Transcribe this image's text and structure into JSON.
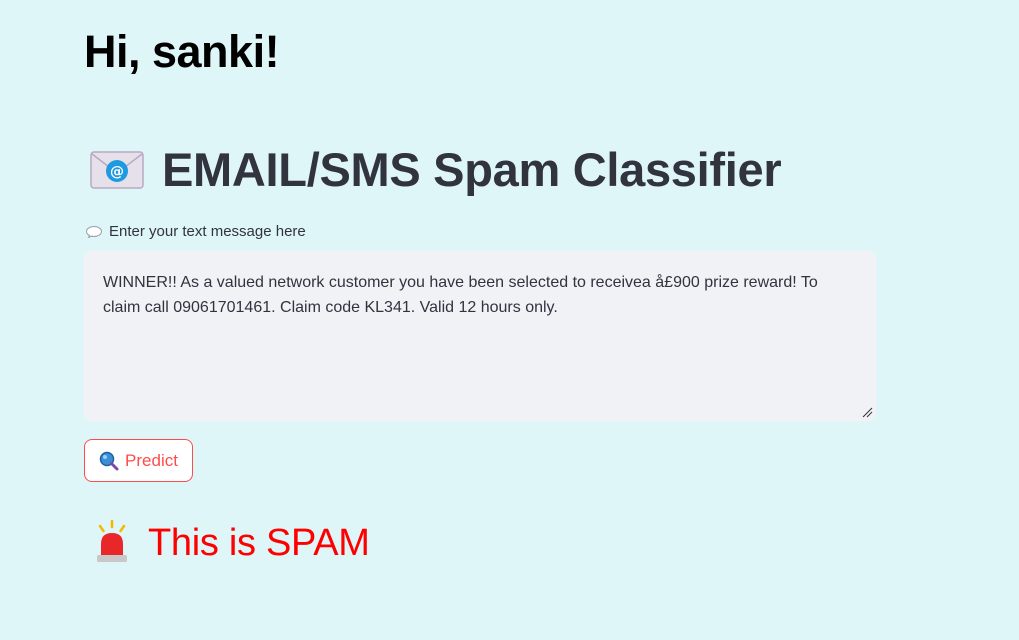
{
  "greeting": "Hi, sanki!",
  "app": {
    "title": "EMAIL/SMS Spam Classifier",
    "title_icon": "envelope-email-icon"
  },
  "input": {
    "label": "Enter your text message here",
    "label_icon": "speech-bubble-icon",
    "value": "WINNER!! As a valued network customer you have been selected to receivea å£900 prize reward! To claim call 09061701461. Claim code KL341. Valid 12 hours only."
  },
  "predict_button": {
    "label": "Predict",
    "icon": "magnifier-icon"
  },
  "result": {
    "text": "This is SPAM",
    "icon": "siren-icon"
  },
  "colors": {
    "background": "#dff6f8",
    "accent": "#ff4b4b",
    "result": "#ff0000",
    "text": "#31333f"
  }
}
